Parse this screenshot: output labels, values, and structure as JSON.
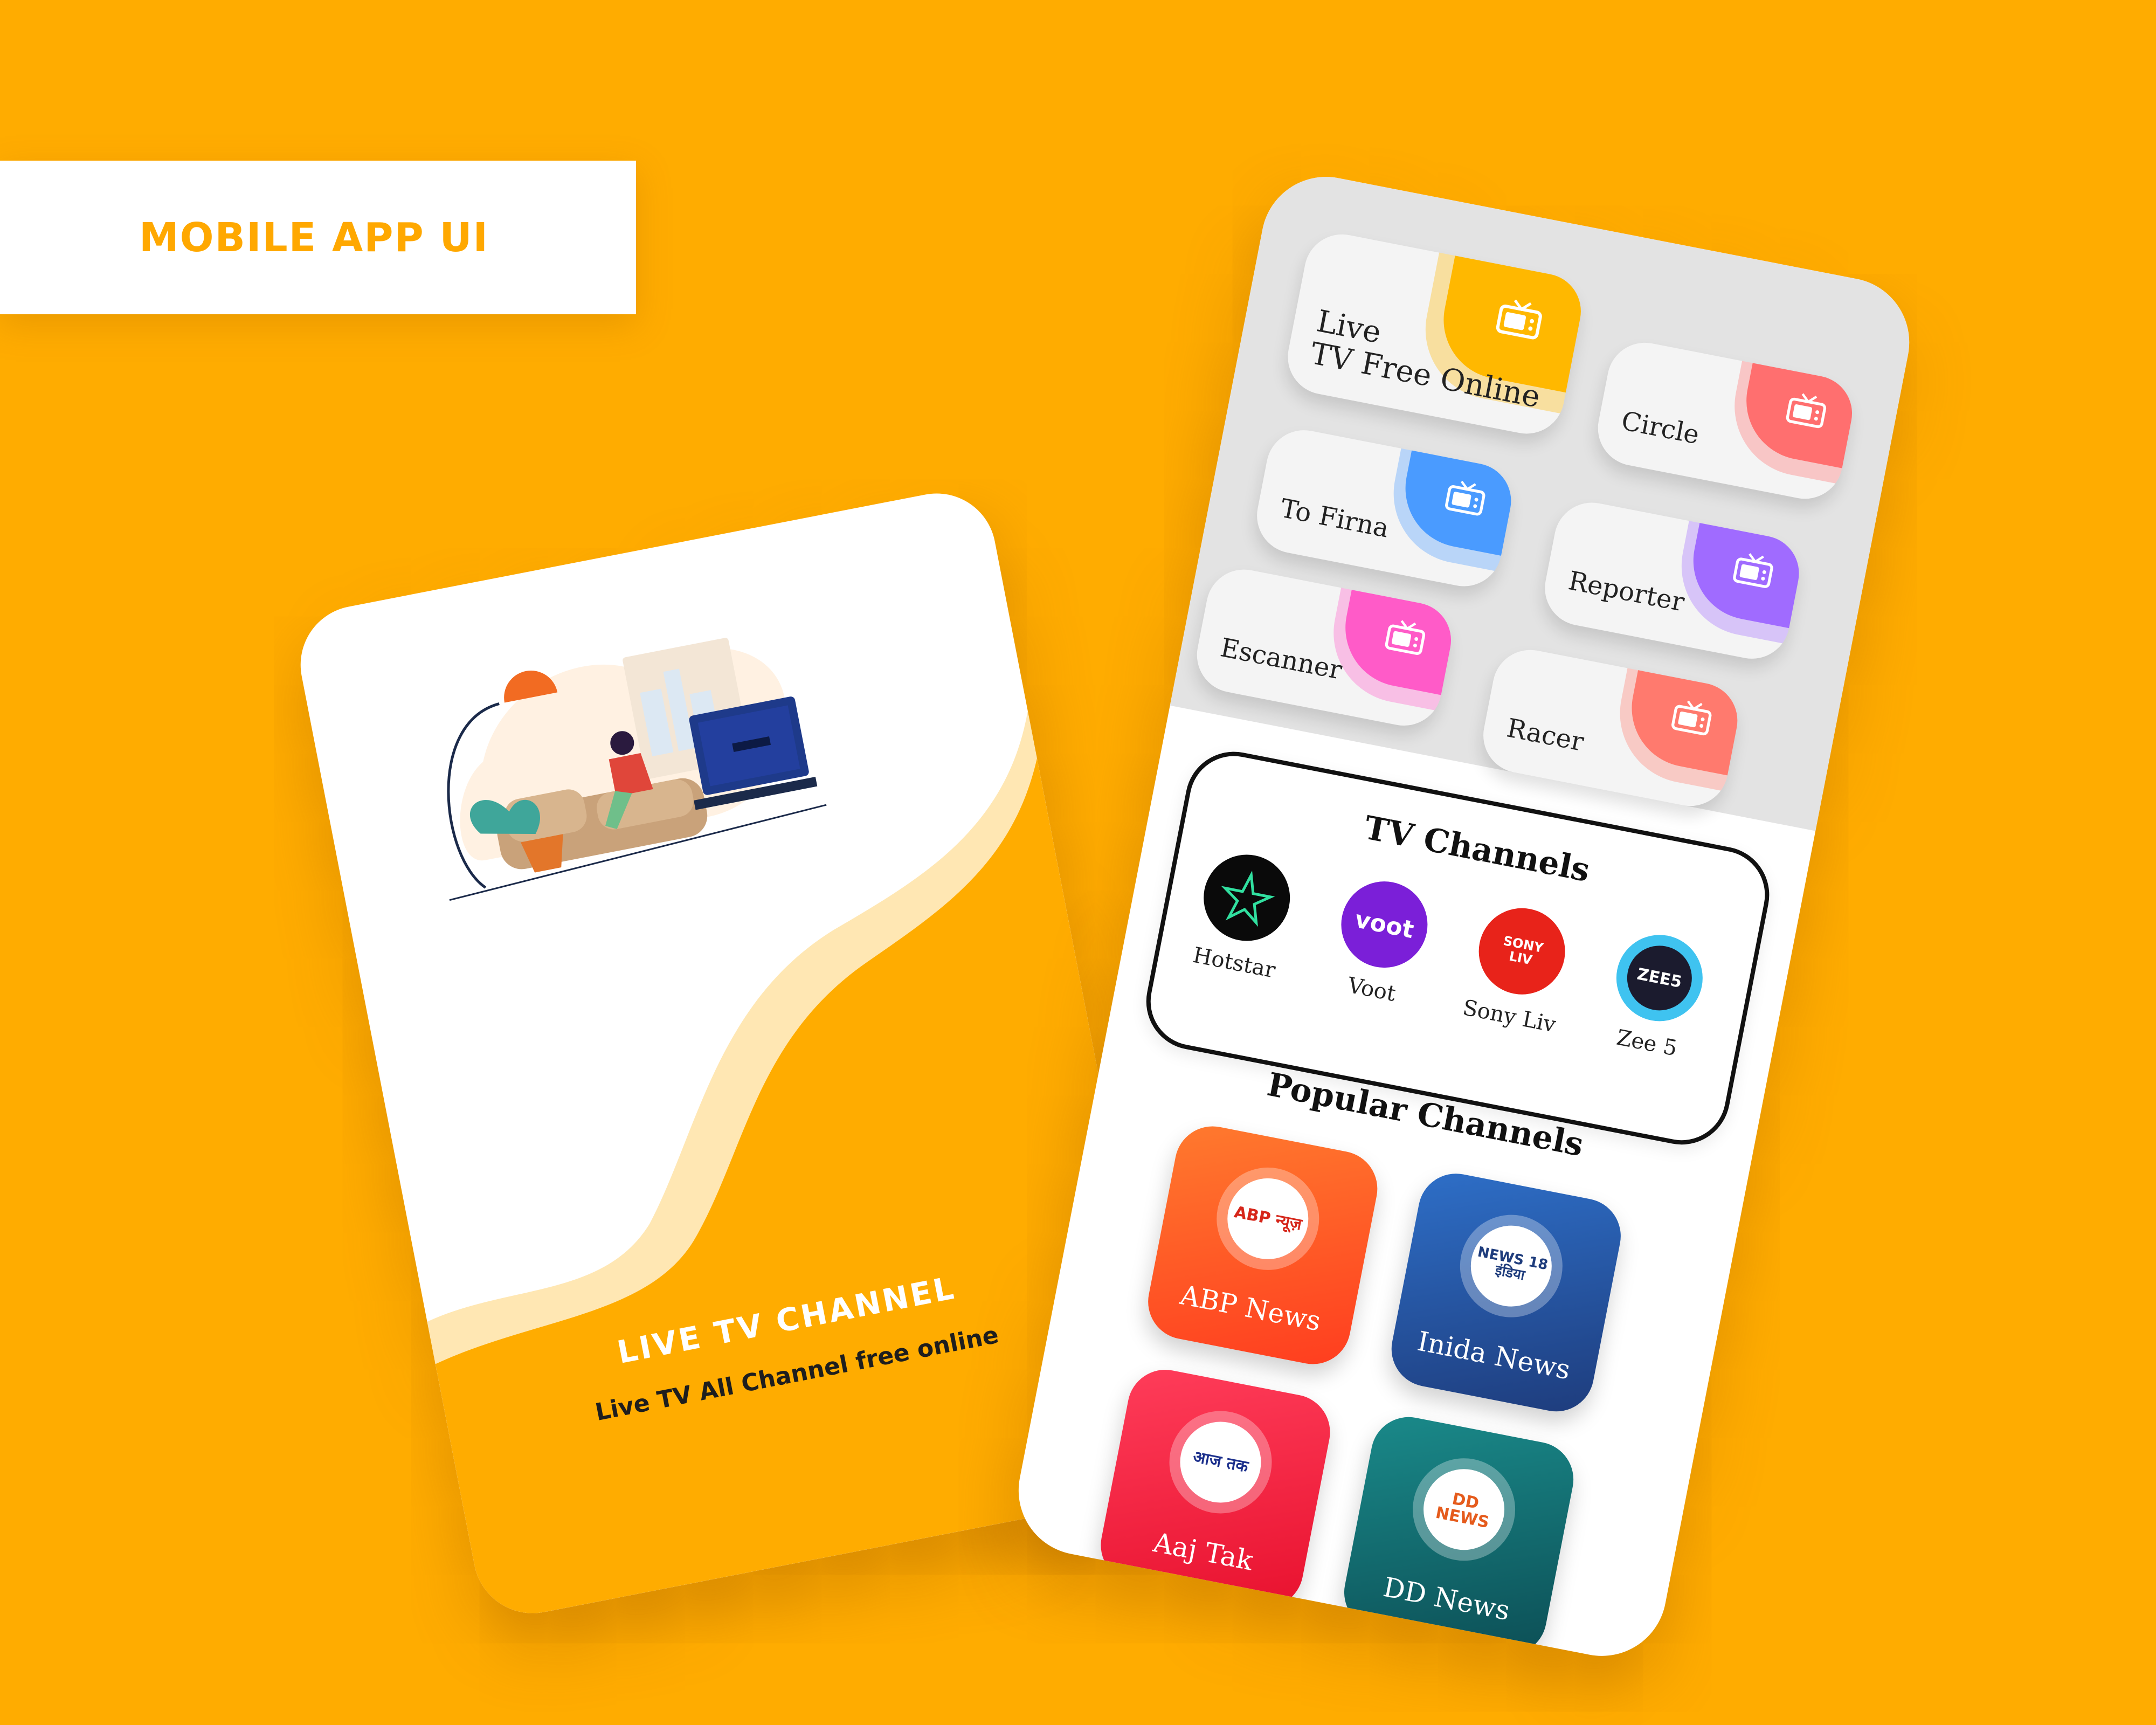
{
  "header": {
    "label": "MOBILE APP UI"
  },
  "splash": {
    "title": "LIVE TV CHANNEL",
    "subtitle": "Live TV All Channel free online"
  },
  "home": {
    "categories": [
      {
        "label_line1": "Live",
        "label_line2": "TV Free Online",
        "color": "#FFB800"
      },
      {
        "label": "Circle",
        "color": "#FF6F6F"
      },
      {
        "label": "To Firna",
        "color": "#4A9BFF"
      },
      {
        "label": "Reporter",
        "color": "#A06BFF"
      },
      {
        "label": "Escanner",
        "color": "#FF5BC8"
      },
      {
        "label": "Racer",
        "color": "#FF7A6E"
      }
    ],
    "tv_channels_title": "TV Channels",
    "tv_channels": [
      {
        "name": "Hotstar",
        "logo": "star-icon",
        "bg": "#0A0A0A"
      },
      {
        "name": "Voot",
        "logo": "voot",
        "bg": "#7B1FD8"
      },
      {
        "name": "Sony Liv",
        "logo": "SONY LIV",
        "bg": "#E8231A"
      },
      {
        "name": "Zee 5",
        "logo": "ZEE5",
        "bg": "#3FC3F0"
      }
    ],
    "popular_title": "Popular Channels",
    "popular": [
      {
        "name": "ABP News",
        "logo": "ABP न्यूज़",
        "from": "#FF7A2E",
        "to": "#FF3D1F"
      },
      {
        "name": "Inida News",
        "logo": "NEWS 18 इंडिया",
        "from": "#2E6FC8",
        "to": "#1E3C7C"
      },
      {
        "name": "Aaj Tak",
        "logo": "आज तक",
        "from": "#FF3D5A",
        "to": "#E8112E"
      },
      {
        "name": "DD News",
        "logo": "DD NEWS",
        "from": "#1A8A8A",
        "to": "#0C4E55"
      }
    ]
  }
}
